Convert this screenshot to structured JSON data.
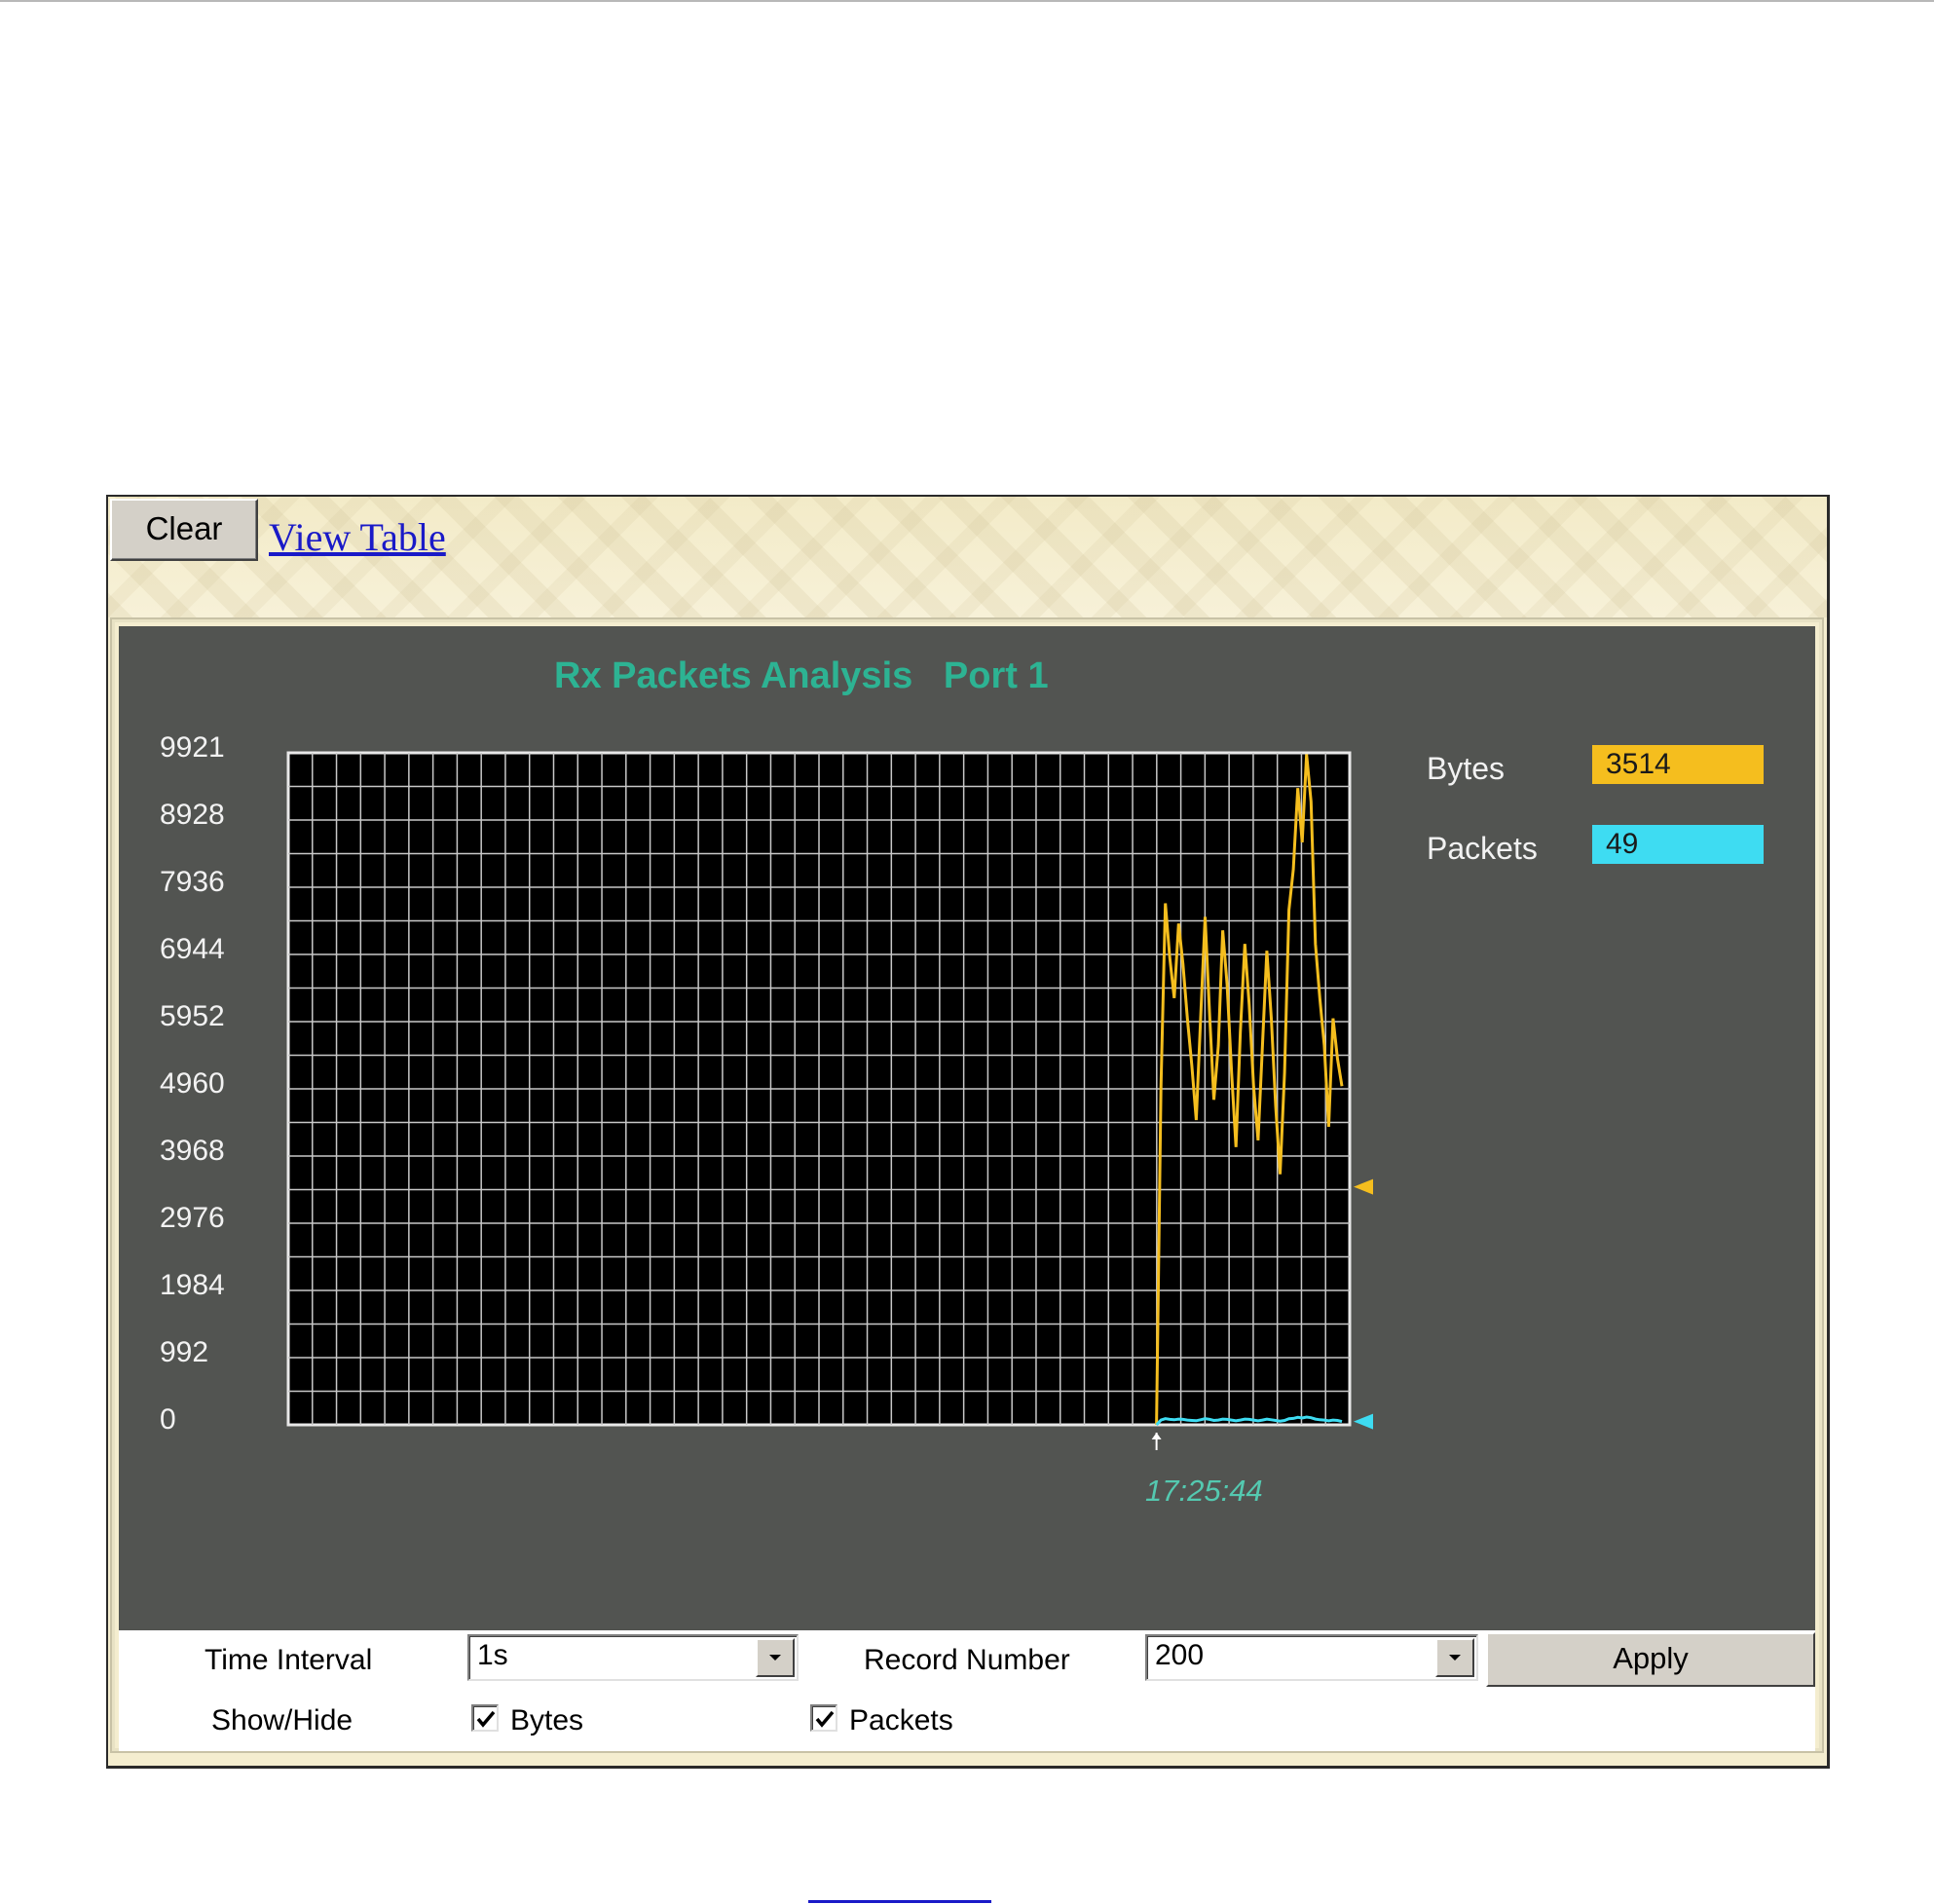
{
  "toolbar": {
    "clear_label": "Clear",
    "view_table_label": "View Table"
  },
  "chart": {
    "title": "Rx Packets Analysis   Port 1",
    "time_label": "17:25:44"
  },
  "legend": [
    {
      "label": "Bytes",
      "value": "3514",
      "color": "#f5be1e"
    },
    {
      "label": "Packets",
      "value": "49",
      "color": "#3edcf2"
    }
  ],
  "controls": {
    "time_interval_label": "Time Interval",
    "time_interval_value": "1s",
    "record_number_label": "Record Number",
    "record_number_value": "200",
    "apply_label": "Apply",
    "show_hide_label": "Show/Hide",
    "bytes_label": "Bytes",
    "packets_label": "Packets",
    "bytes_checked": true,
    "packets_checked": true
  },
  "colors": {
    "background": "#525451",
    "plot_background": "#000000",
    "grid": "#c8c8c8",
    "title": "#2db393",
    "bytes_line": "#f5be1e",
    "packets_line": "#3edcf2"
  },
  "chart_data": {
    "type": "line",
    "title": "Rx Packets Analysis   Port 1",
    "y_ticks": [
      "9921",
      "8928",
      "7936",
      "6944",
      "5952",
      "4960",
      "3968",
      "2976",
      "1984",
      "992",
      "0"
    ],
    "ylim": [
      0,
      9921
    ],
    "grid": true,
    "record_number": 200,
    "x_label_at_start": "17:25:44",
    "current_markers": {
      "Bytes": 3514,
      "Packets": 49
    },
    "series": [
      {
        "name": "Bytes",
        "color": "#f5be1e",
        "values": [
          0,
          5000,
          7700,
          6900,
          6300,
          7400,
          6800,
          6000,
          5300,
          4500,
          6000,
          7500,
          6100,
          4800,
          5600,
          7300,
          6500,
          5200,
          4100,
          5800,
          7100,
          6200,
          5000,
          4200,
          5600,
          7000,
          6000,
          4700,
          3700,
          5200,
          7600,
          8200,
          9400,
          8600,
          9900,
          9200,
          7100,
          6300,
          5600,
          4400,
          6000,
          5400,
          5000
        ]
      },
      {
        "name": "Packets",
        "color": "#3edcf2",
        "values": [
          0,
          70,
          90,
          80,
          75,
          85,
          80,
          70,
          65,
          60,
          75,
          90,
          80,
          65,
          70,
          85,
          80,
          70,
          60,
          70,
          85,
          80,
          70,
          60,
          70,
          85,
          75,
          65,
          55,
          65,
          90,
          95,
          110,
          100,
          115,
          105,
          85,
          75,
          70,
          60,
          70,
          65,
          49
        ]
      }
    ]
  }
}
